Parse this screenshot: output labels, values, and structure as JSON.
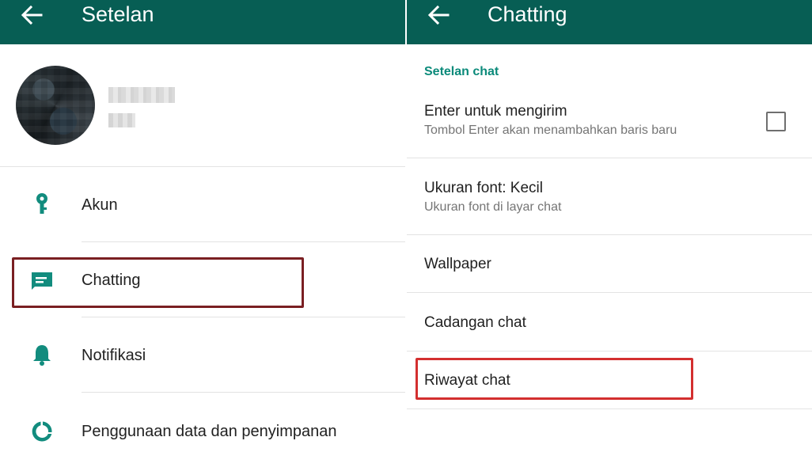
{
  "left": {
    "appbar": {
      "title": "Setelan",
      "back_icon": "arrow-back-icon"
    },
    "menu": [
      {
        "label": "Akun",
        "icon": "key-icon"
      },
      {
        "label": "Chatting",
        "icon": "chat-icon"
      },
      {
        "label": "Notifikasi",
        "icon": "bell-icon"
      },
      {
        "label": "Penggunaan data dan penyimpanan",
        "icon": "data-usage-icon"
      }
    ]
  },
  "right": {
    "appbar": {
      "title": "Chatting",
      "back_icon": "arrow-back-icon"
    },
    "section_header": "Setelan chat",
    "prefs": [
      {
        "title": "Enter untuk mengirim",
        "subtitle": "Tombol Enter akan menambahkan baris baru",
        "checked": false
      },
      {
        "title": "Ukuran font: Kecil",
        "subtitle": "Ukuran font di layar chat"
      },
      {
        "title": "Wallpaper"
      },
      {
        "title": "Cadangan chat"
      },
      {
        "title": "Riwayat chat"
      }
    ]
  },
  "colors": {
    "appbar": "#075e54",
    "accent": "#128c7e",
    "highlight_dark": "#7a1f22",
    "highlight_red": "#d32f2f"
  }
}
